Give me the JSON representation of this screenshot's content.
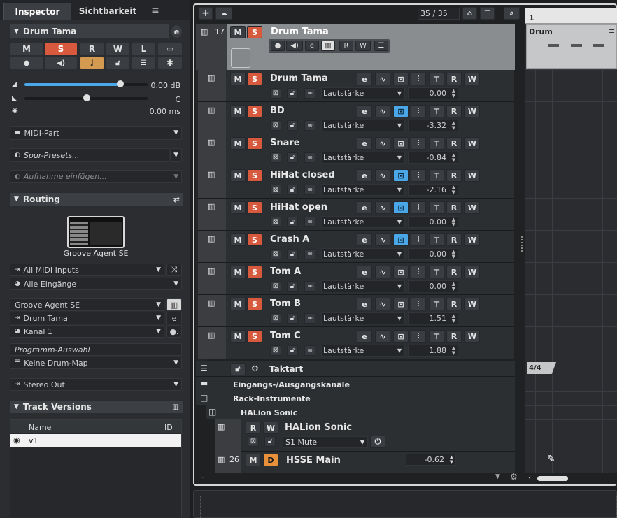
{
  "inspector": {
    "tabs": [
      "Inspector",
      "Sichtbarkeit"
    ],
    "menu_icon": "hamburger-icon",
    "track_name": "Drum Tama",
    "buttons": {
      "m": "M",
      "s": "S",
      "r": "R",
      "w": "W",
      "l": "L"
    },
    "volume": "0.00 dB",
    "pan": "C",
    "delay": "0.00 ms",
    "midi_part": "MIDI-Part",
    "spur_presets": "Spur-Presets...",
    "aufnahme": "Aufnahme einfügen...",
    "routing": "Routing",
    "instrument": "Groove Agent SE",
    "input": "All MIDI Inputs",
    "input_ch": "Alle Eingänge",
    "output": "Groove Agent SE",
    "output_track": "Drum Tama",
    "kanal": "Kanal 1",
    "programm": "Programm-Auswahl",
    "drum_map": "Keine Drum-Map",
    "stereo": "Stereo Out",
    "track_versions": "Track Versions",
    "tv_cols": [
      "Name",
      "ID"
    ],
    "tv_row": "v1"
  },
  "toolbar": {
    "counter": "35 / 35"
  },
  "folder": {
    "number": "17",
    "name": "Drum Tama",
    "m": "M",
    "s": "S",
    "r": "R",
    "w": "W"
  },
  "tracks": [
    {
      "name": "Drum Tama",
      "param": "Lautstärke",
      "value": "0.00",
      "monitor": false
    },
    {
      "name": "BD",
      "param": "Lautstärke",
      "value": "-3.32",
      "monitor": true
    },
    {
      "name": "Snare",
      "param": "Lautstärke",
      "value": "-0.84",
      "monitor": false
    },
    {
      "name": "HiHat closed",
      "param": "Lautstärke",
      "value": "-2.16",
      "monitor": true
    },
    {
      "name": "HiHat open",
      "param": "Lautstärke",
      "value": "0.00",
      "monitor": true
    },
    {
      "name": "Crash A",
      "param": "Lautstärke",
      "value": "0.00",
      "monitor": true
    },
    {
      "name": "Tom A",
      "param": "Lautstärke",
      "value": "0.00",
      "monitor": false
    },
    {
      "name": "Tom B",
      "param": "Lautstärke",
      "value": "1.51",
      "monitor": false
    },
    {
      "name": "Tom C",
      "param": "Lautstärke",
      "value": "1.88",
      "monitor": false
    }
  ],
  "labels": {
    "m": "M",
    "s": "S",
    "r": "R",
    "w": "W",
    "d": "D"
  },
  "taktart": "Taktart",
  "eingangs": "Eingangs-/Ausgangskanäle",
  "rack": "Rack-Instrumente",
  "halion_folder": "HALion Sonic",
  "halion": {
    "name": "HALion Sonic",
    "param": "S1 Mute"
  },
  "hsse": {
    "number": "26",
    "name": "HSSE Main",
    "value": "-0.62"
  },
  "ruler": {
    "bar": "1",
    "part": "Drum",
    "sig": "4/4"
  }
}
